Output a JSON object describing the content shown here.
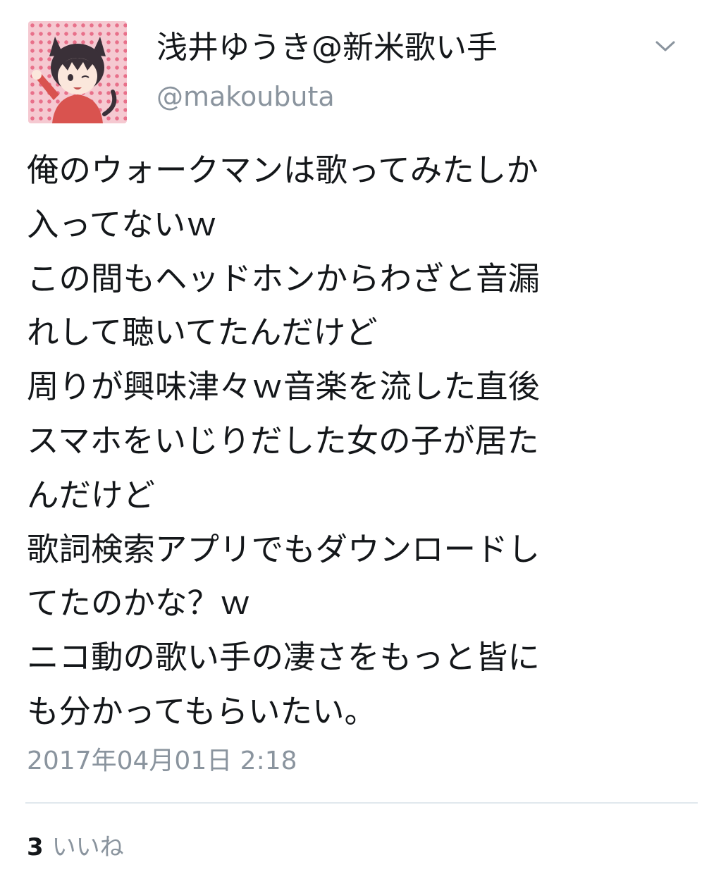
{
  "tweet": {
    "user": {
      "display_name": "浅井ゆうき@新米歌い手",
      "handle": "@makoubuta",
      "avatar_icon": "user-avatar-icon"
    },
    "menu_icon": "chevron-down-icon",
    "body_lines": [
      "俺のウォークマンは歌ってみたしか",
      "入ってないｗ",
      "この間もヘッドホンからわざと音漏",
      "れして聴いてたんだけど",
      "周りが興味津々ｗ音楽を流した直後",
      "スマホをいじりだした女の子が居た",
      "んだけど",
      "歌詞検索アプリでもダウンロードし",
      "てたのかな？ｗ",
      "ニコ動の歌い手の凄さをもっと皆に",
      "も分かってもらいたい。"
    ],
    "timestamp": "2017年04月01日 2:18",
    "likes": {
      "count": "3",
      "label": "いいね"
    }
  },
  "colors": {
    "text": "#14171a",
    "secondary": "#8a949e",
    "divider": "#e1e8ed",
    "avatar_bg": "#f5c9d1",
    "avatar_dots": "#e8708a"
  }
}
